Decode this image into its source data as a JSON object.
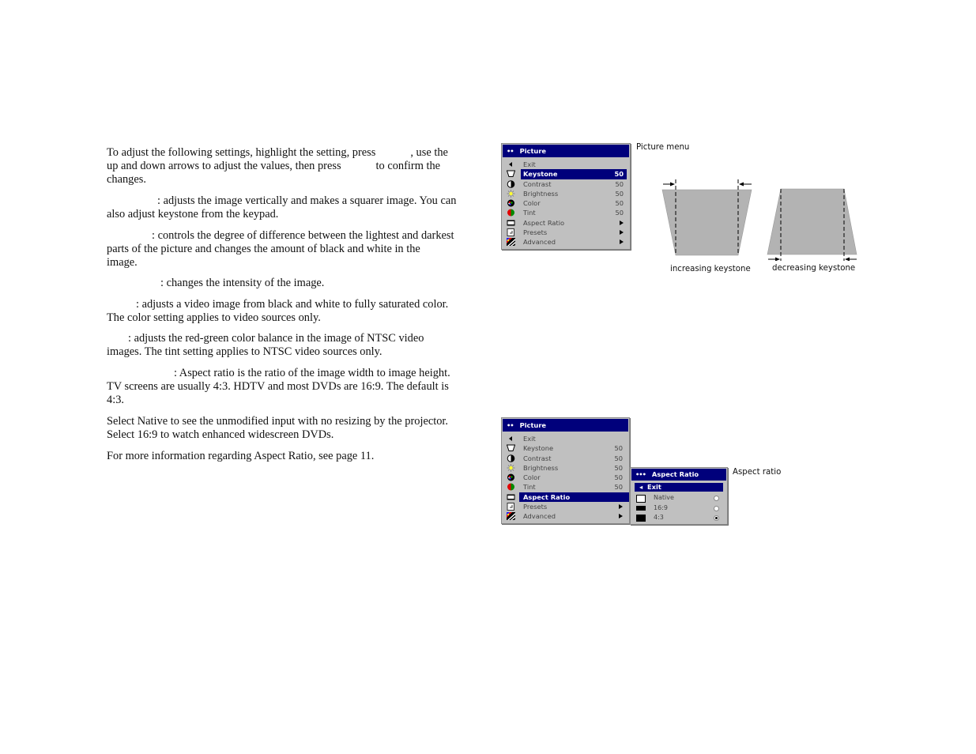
{
  "instructions": {
    "p1": [
      "To adjust the following settings, highlight the setting, press",
      ", use the",
      "up and down arrows to adjust the values, then press",
      "to confirm the",
      "changes."
    ],
    "keystone": [
      ": adjusts the image vertically and makes a squarer image. You can",
      "also adjust keystone from the keypad."
    ],
    "contrast": [
      ": controls the degree of difference between the lightest and darkest",
      "parts of the picture and changes the amount of black and white in the",
      "image."
    ],
    "brightness": [
      ": changes the intensity of the image."
    ],
    "color": [
      ": adjusts a video image from black and white to fully saturated color.",
      "The color setting applies to video sources only."
    ],
    "tint": [
      ": adjusts the red-green color balance in the image of NTSC video",
      "images. The tint setting applies to NTSC video sources only."
    ],
    "aspect": [
      ": Aspect ratio is the ratio of the image width to image height.",
      "TV screens are usually 4:3. HDTV and most DVDs are 16:9. The default is",
      "4:3."
    ],
    "native": [
      "Select Native to see the unmodified input with no resizing by the projector.",
      "Select 16:9 to watch enhanced widescreen DVDs."
    ],
    "more": [
      "For more information regarding Aspect Ratio, see page 11."
    ]
  },
  "picture_menu_1": {
    "title": "Picture",
    "caption": "Picture menu",
    "selected": "Keystone",
    "items": [
      {
        "label": "Exit",
        "value": "",
        "icon": "exit-arrow-icon"
      },
      {
        "label": "Keystone",
        "value": "50",
        "icon": "keystone-icon"
      },
      {
        "label": "Contrast",
        "value": "50",
        "icon": "contrast-icon"
      },
      {
        "label": "Brightness",
        "value": "50",
        "icon": "brightness-icon"
      },
      {
        "label": "Color",
        "value": "50",
        "icon": "color-icon"
      },
      {
        "label": "Tint",
        "value": "50",
        "icon": "tint-icon"
      },
      {
        "label": "Aspect Ratio",
        "value": "submenu",
        "icon": "aspect-ratio-icon"
      },
      {
        "label": "Presets",
        "value": "submenu",
        "icon": "presets-icon"
      },
      {
        "label": "Advanced",
        "value": "submenu",
        "icon": "advanced-icon"
      }
    ]
  },
  "keystone_diagram": {
    "increasing_label": "increasing keystone",
    "decreasing_label": "decreasing keystone"
  },
  "picture_menu_2": {
    "title": "Picture",
    "selected": "Aspect Ratio",
    "items": [
      {
        "label": "Exit",
        "value": ""
      },
      {
        "label": "Keystone",
        "value": "50"
      },
      {
        "label": "Contrast",
        "value": "50"
      },
      {
        "label": "Brightness",
        "value": "50"
      },
      {
        "label": "Color",
        "value": "50"
      },
      {
        "label": "Tint",
        "value": "50"
      },
      {
        "label": "Aspect Ratio",
        "value": ""
      },
      {
        "label": "Presets",
        "value": "submenu"
      },
      {
        "label": "Advanced",
        "value": "submenu"
      }
    ]
  },
  "aspect_menu": {
    "title": "Aspect Ratio",
    "caption": "Aspect ratio",
    "exit_label": "Exit",
    "options": [
      {
        "label": "Native",
        "selected": false
      },
      {
        "label": "16:9",
        "selected": false
      },
      {
        "label": "4:3",
        "selected": true
      }
    ]
  },
  "colors": {
    "menu_header": "#00007b",
    "menu_bg": "#c0c0c0",
    "diagram_fill": "#b3b3b3"
  }
}
